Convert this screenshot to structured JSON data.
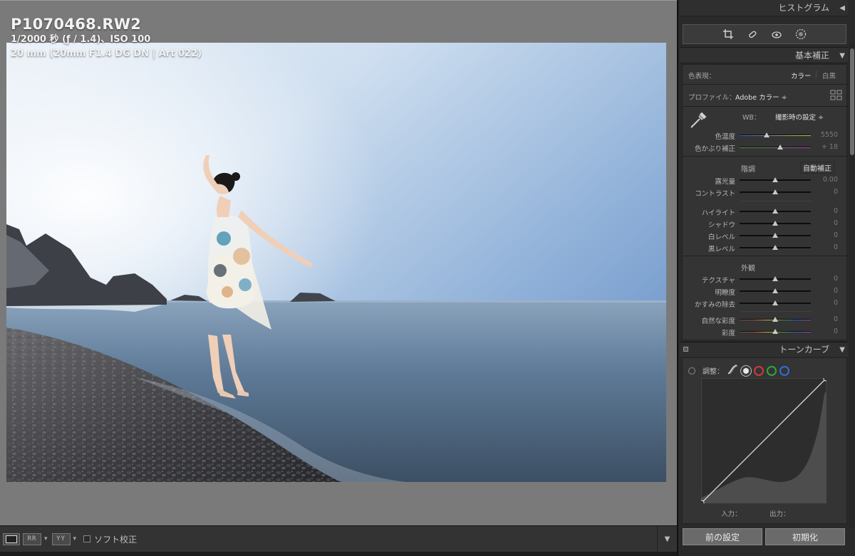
{
  "photo": {
    "filename": "P1070468.RW2",
    "exposure_line": "1/2000 秒 (ƒ / 1.4)、ISO 100",
    "lens_line": "20 mm (20mm F1.4 DG DN | Art 022)"
  },
  "toolbar": {
    "compare_left": "RR",
    "compare_right": "YY",
    "soft_proof_label": "ソフト校正"
  },
  "panel": {
    "histogram_title": "ヒストグラム",
    "basic_title": "基本補正",
    "treatment_label": "色表現：",
    "treatment_color": "カラー",
    "treatment_bw": "白黒",
    "profile_label": "プロファイル：",
    "profile_value": "Adobe カラー ÷",
    "wb_label": "WB：",
    "wb_value": "撮影時の設定 ÷",
    "tone_title": "階調",
    "auto_label": "自動補正",
    "presence_title": "外観",
    "sliders": {
      "temp": {
        "name": "色温度",
        "value": "5550",
        "pos": 0.38
      },
      "tint": {
        "name": "色かぶり補正",
        "value": "+ 18",
        "pos": 0.57
      },
      "exposure": {
        "name": "露光量",
        "value": "0.00",
        "pos": 0.5
      },
      "contrast": {
        "name": "コントラスト",
        "value": "0",
        "pos": 0.5
      },
      "highlights": {
        "name": "ハイライト",
        "value": "0",
        "pos": 0.5
      },
      "shadows": {
        "name": "シャドウ",
        "value": "0",
        "pos": 0.5
      },
      "whites": {
        "name": "白レベル",
        "value": "0",
        "pos": 0.5
      },
      "blacks": {
        "name": "黒レベル",
        "value": "0",
        "pos": 0.5
      },
      "texture": {
        "name": "テクスチャ",
        "value": "0",
        "pos": 0.5
      },
      "clarity": {
        "name": "明瞭度",
        "value": "0",
        "pos": 0.5
      },
      "dehaze": {
        "name": "かすみの除去",
        "value": "0",
        "pos": 0.5
      },
      "vibrance": {
        "name": "自然な彩度",
        "value": "0",
        "pos": 0.5
      },
      "saturation": {
        "name": "彩度",
        "value": "0",
        "pos": 0.5
      }
    },
    "tone_curve_title": "トーンカーブ",
    "adjust_label": "調整：",
    "input_label": "入力：",
    "output_label": "出力：",
    "previous_button": "前の設定",
    "reset_button": "初期化"
  },
  "colors": {
    "panel_bg": "#343434",
    "viewer_bg": "#7a7a7a",
    "red_channel": "#d23a3a",
    "green_channel": "#2fa83a",
    "blue_channel": "#2f6fd8"
  }
}
